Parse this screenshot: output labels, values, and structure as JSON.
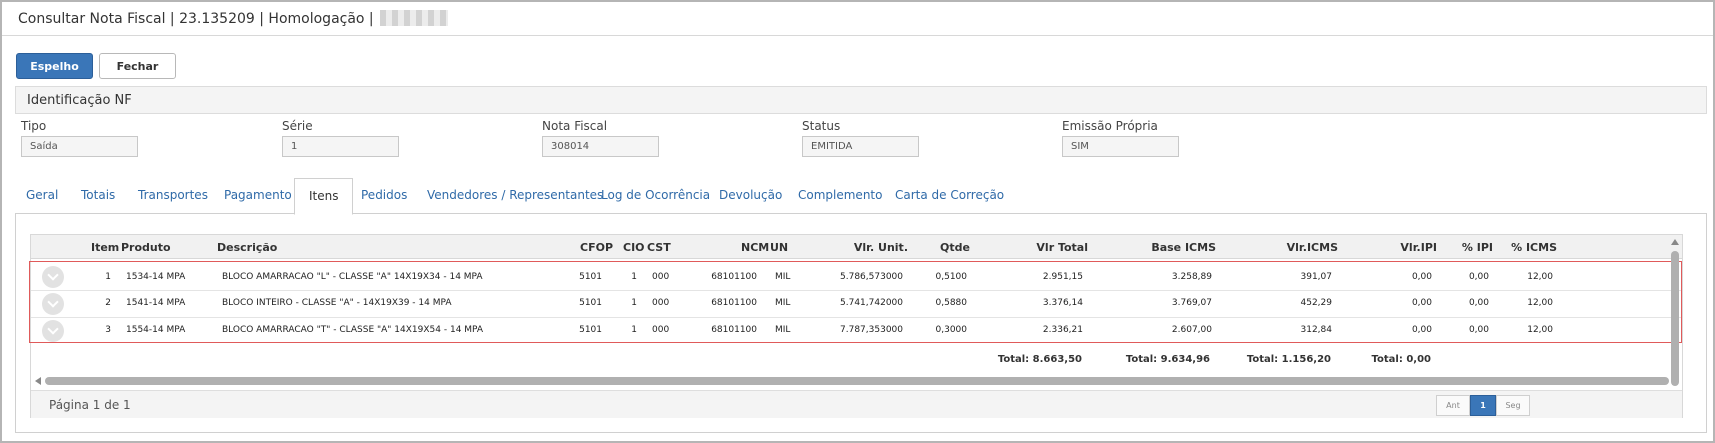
{
  "title": {
    "text": "Consultar Nota Fiscal | 23.135209 | Homologação |"
  },
  "toolbar": {
    "espelho_label": "Espelho",
    "fechar_label": "Fechar",
    "primary_color": "#3a76b8"
  },
  "identificacao": {
    "header": "Identificação NF",
    "fields": [
      {
        "label": "Tipo",
        "value": "Saída"
      },
      {
        "label": "Série",
        "value": "1"
      },
      {
        "label": "Nota Fiscal",
        "value": "308014"
      },
      {
        "label": "Status",
        "value": "EMITIDA"
      },
      {
        "label": "Emissão Própria",
        "value": "SIM"
      }
    ]
  },
  "tabs": [
    {
      "label": "Geral"
    },
    {
      "label": "Totais"
    },
    {
      "label": "Transportes"
    },
    {
      "label": "Pagamento"
    },
    {
      "label": "Itens",
      "active": true
    },
    {
      "label": "Pedidos"
    },
    {
      "label": "Vendedores / Representantes"
    },
    {
      "label": "Log de Ocorrência"
    },
    {
      "label": "Devolução"
    },
    {
      "label": "Complemento"
    },
    {
      "label": "Carta de Correção"
    }
  ],
  "grid": {
    "columns": [
      "Item",
      "Produto",
      "Descrição",
      "CFOP",
      "CIO",
      "CST",
      "NCM",
      "UN",
      "Vlr. Unit.",
      "Qtde",
      "Vlr Total",
      "Base ICMS",
      "Vlr.ICMS",
      "Vlr.IPI",
      "% IPI",
      "% ICMS"
    ],
    "rows": [
      {
        "item": "1",
        "produto": "1534-14 MPA",
        "descricao": "BLOCO AMARRACAO \"L\" - CLASSE \"A\" 14X19X34 - 14 MPA",
        "cfop": "5101",
        "cio": "1",
        "cst": "000",
        "ncm": "68101100",
        "un": "MIL",
        "vlr_unit": "5.786,573000",
        "qtde": "0,5100",
        "vlr_total": "2.951,15",
        "base_icms": "3.258,89",
        "vlr_icms": "391,07",
        "vlr_ipi": "0,00",
        "pct_ipi": "0,00",
        "pct_icms": "12,00"
      },
      {
        "item": "2",
        "produto": "1541-14 MPA",
        "descricao": "BLOCO INTEIRO - CLASSE \"A\" - 14X19X39 - 14 MPA",
        "cfop": "5101",
        "cio": "1",
        "cst": "000",
        "ncm": "68101100",
        "un": "MIL",
        "vlr_unit": "5.741,742000",
        "qtde": "0,5880",
        "vlr_total": "3.376,14",
        "base_icms": "3.769,07",
        "vlr_icms": "452,29",
        "vlr_ipi": "0,00",
        "pct_ipi": "0,00",
        "pct_icms": "12,00"
      },
      {
        "item": "3",
        "produto": "1554-14 MPA",
        "descricao": "BLOCO AMARRACAO \"T\" - CLASSE \"A\" 14X19X54 - 14 MPA",
        "cfop": "5101",
        "cio": "1",
        "cst": "000",
        "ncm": "68101100",
        "un": "MIL",
        "vlr_unit": "7.787,353000",
        "qtde": "0,3000",
        "vlr_total": "2.336,21",
        "base_icms": "2.607,00",
        "vlr_icms": "312,84",
        "vlr_ipi": "0,00",
        "pct_ipi": "0,00",
        "pct_icms": "12,00"
      }
    ],
    "totals": {
      "vlr_total": "Total: 8.663,50",
      "base_icms": "Total: 9.634,96",
      "vlr_icms": "Total: 1.156,20",
      "vlr_ipi": "Total: 0,00"
    },
    "highlight_color": "#e05a5a"
  },
  "pager": {
    "info": "Página 1 de 1",
    "prev_label": "Ant",
    "current_page": "1",
    "next_label": "Seg",
    "active_color": "#3a76b8"
  }
}
